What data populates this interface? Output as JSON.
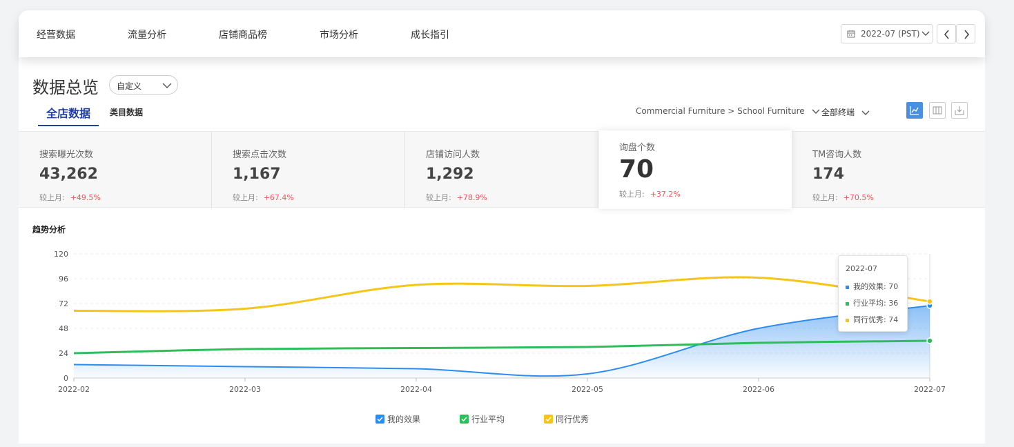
{
  "nav": {
    "items": [
      "经营数据",
      "流量分析",
      "店铺商品榜",
      "市场分析",
      "成长指引"
    ],
    "period": "2022-07 (PST)"
  },
  "page": {
    "title": "数据总览",
    "range_select": "自定义",
    "tabs": [
      "全店数据",
      "类目数据"
    ],
    "category_filter": "Commercial Furniture > School Furniture",
    "terminal_filter": "全部终端"
  },
  "kpis": [
    {
      "label": "搜索曝光次数",
      "value": "43,262",
      "compare_label": "较上月:",
      "change": "+49.5%"
    },
    {
      "label": "搜索点击次数",
      "value": "1,167",
      "compare_label": "较上月:",
      "change": "+67.4%"
    },
    {
      "label": "店铺访问人数",
      "value": "1,292",
      "compare_label": "较上月:",
      "change": "+78.9%"
    },
    {
      "label": "询盘个数",
      "value": "70",
      "compare_label": "较上月:",
      "change": "+37.2%"
    },
    {
      "label": "TM咨询人数",
      "value": "174",
      "compare_label": "较上月:",
      "change": "+70.5%"
    }
  ],
  "trend": {
    "title": "趋势分析",
    "tooltip": {
      "date": "2022-07",
      "rows": [
        {
          "name": "我的效果",
          "value": "70"
        },
        {
          "name": "行业平均",
          "value": "36"
        },
        {
          "name": "同行优秀",
          "value": "74"
        }
      ]
    }
  },
  "colors": {
    "mine": "#2d8cf0",
    "industry": "#2dbd5a",
    "peer": "#f5c518",
    "primary": "#1f3ea8",
    "up": "#f0555a"
  },
  "chart_data": {
    "type": "line",
    "x": [
      "2022-02",
      "2022-03",
      "2022-04",
      "2022-05",
      "2022-06",
      "2022-07"
    ],
    "ylim": [
      0,
      120
    ],
    "yticks": [
      0,
      24,
      48,
      72,
      96,
      120
    ],
    "grid": true,
    "legend_position": "bottom",
    "series": [
      {
        "name": "我的效果",
        "values": [
          13,
          11,
          9,
          4,
          48,
          70
        ],
        "area": true
      },
      {
        "name": "行业平均",
        "values": [
          24,
          28,
          29,
          30,
          34,
          36
        ]
      },
      {
        "name": "同行优秀",
        "values": [
          65,
          67,
          90,
          89,
          97,
          74
        ]
      }
    ]
  }
}
